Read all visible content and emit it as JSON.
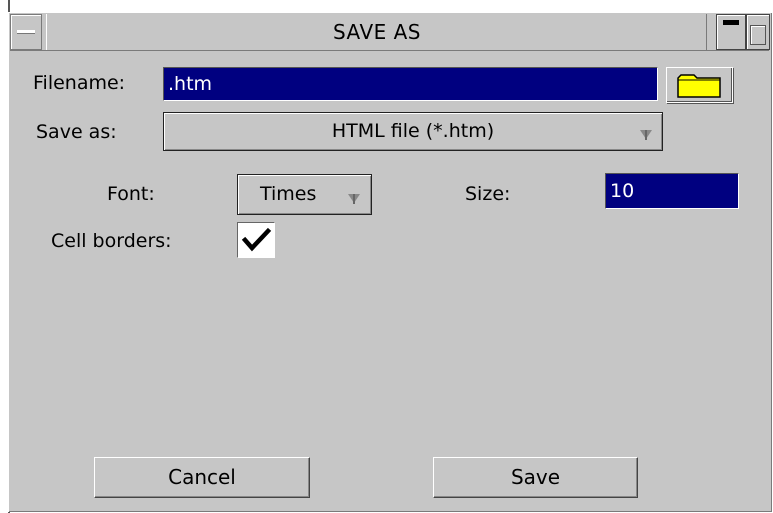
{
  "window": {
    "title": "SAVE AS"
  },
  "form": {
    "filename_label": "Filename:",
    "filename_value": ".htm",
    "saveas_label": "Save as:",
    "saveas_value": "HTML file (*.htm)",
    "font_label": "Font:",
    "font_value": "Times",
    "size_label": "Size:",
    "size_value": "10",
    "cell_borders_label": "Cell borders:",
    "cell_borders_checked": true
  },
  "buttons": {
    "cancel": "Cancel",
    "save": "Save"
  },
  "icons": {
    "window_menu": "window-menu-icon",
    "minimize": "minimize-icon",
    "maximize": "maximize-icon",
    "folder": "folder-icon",
    "dropdown_arrow": "dropdown-arrow-icon",
    "check": "checkmark-icon"
  },
  "colors": {
    "dialog_bg": "#c6c6c6",
    "field_bg": "#000080",
    "field_text": "#ffffff",
    "folder": "#ffff00"
  }
}
